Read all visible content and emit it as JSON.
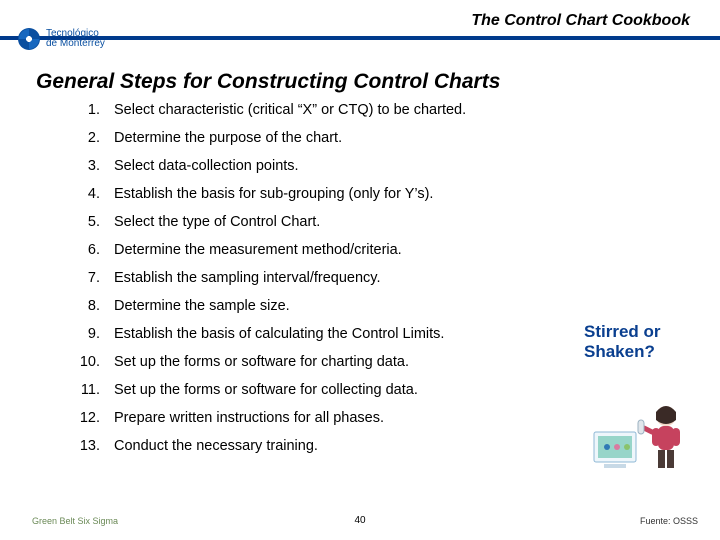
{
  "header": {
    "title": "The Control Chart Cookbook",
    "logo": {
      "line1": "Tecnológico",
      "line2": "de Monterrey"
    }
  },
  "slide_title": "General Steps for Constructing Control Charts",
  "steps": [
    {
      "n": "1.",
      "text": "Select characteristic (critical “X” or CTQ) to be charted."
    },
    {
      "n": "2.",
      "text": "Determine the purpose of the chart."
    },
    {
      "n": "3.",
      "text": "Select data-collection points."
    },
    {
      "n": "4.",
      "text": "Establish the basis for sub-grouping (only for Y’s)."
    },
    {
      "n": "5.",
      "text": "Select the type of Control Chart."
    },
    {
      "n": "6.",
      "text": "Determine the measurement method/criteria."
    },
    {
      "n": "7.",
      "text": "Establish the sampling interval/frequency."
    },
    {
      "n": "8.",
      "text": "Determine the sample size."
    },
    {
      "n": "9.",
      "text": "Establish the basis of calculating the Control Limits."
    },
    {
      "n": "10.",
      "text": "Set up the forms or software for charting data."
    },
    {
      "n": "11.",
      "text": "Set up the forms or software for collecting data."
    },
    {
      "n": "12.",
      "text": "Prepare written instructions for all phases."
    },
    {
      "n": "13.",
      "text": "Conduct the necessary training."
    }
  ],
  "callout": "Stirred or Shaken?",
  "footer": {
    "left": "Green Belt Six Sigma",
    "center": "40",
    "right": "Fuente: OSSS"
  }
}
